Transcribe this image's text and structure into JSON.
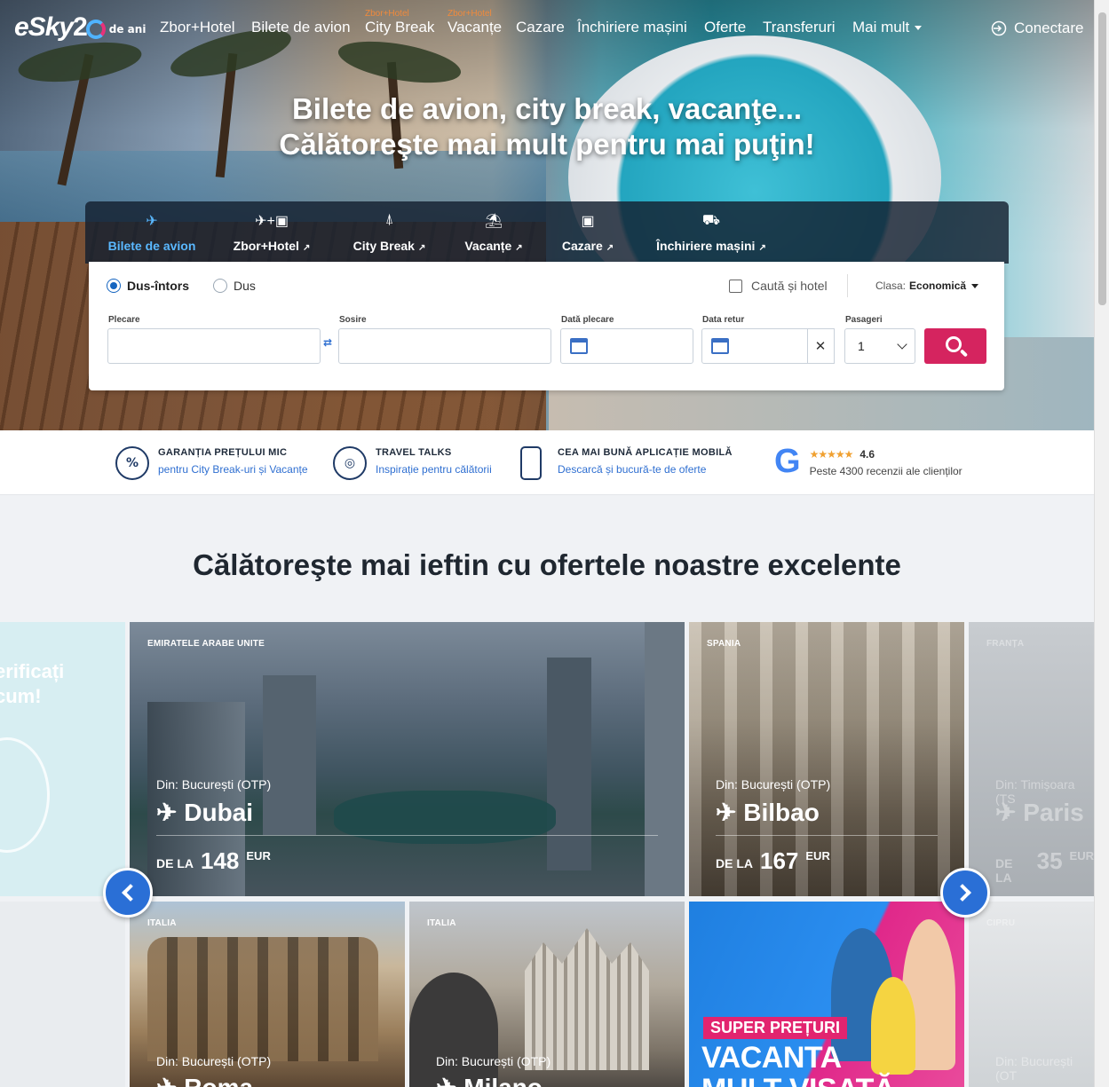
{
  "brand": {
    "logo_text": "eSky",
    "logo_number": "2",
    "logo_suffix": "de ani"
  },
  "nav": {
    "items": [
      {
        "label": "Zbor+Hotel",
        "sup": ""
      },
      {
        "label": "Bilete de avion",
        "sup": ""
      },
      {
        "label": "City Break",
        "sup": "Zbor+Hotel"
      },
      {
        "label": "Vacanțe",
        "sup": "Zbor+Hotel"
      },
      {
        "label": "Cazare",
        "sup": ""
      },
      {
        "label": "Închiriere mașini",
        "sup": ""
      },
      {
        "label": "Oferte",
        "sup": ""
      },
      {
        "label": "Transferuri",
        "sup": ""
      },
      {
        "label": "Mai mult",
        "sup": ""
      }
    ],
    "login_label": "Conectare"
  },
  "hero": {
    "title_line1": "Bilete de avion, city break, vacanţe...",
    "title_line2": "Călătoreşte mai mult pentru mai puţin!"
  },
  "search": {
    "tabs": [
      {
        "label": "Bilete de avion",
        "icon": "plane-icon",
        "active": true
      },
      {
        "label": "Zbor+Hotel",
        "icon": "plane-hotel-icon",
        "active": false
      },
      {
        "label": "City Break",
        "icon": "eiffel-tower-icon",
        "active": false
      },
      {
        "label": "Vacanțe",
        "icon": "beach-umbrella-icon",
        "active": false
      },
      {
        "label": "Cazare",
        "icon": "hotel-icon",
        "active": false
      },
      {
        "label": "Închiriere mașini",
        "icon": "car-icon",
        "active": false
      }
    ],
    "trip_types": [
      "Dus-întors",
      "Dus"
    ],
    "selected_trip": "Dus-întors",
    "hotel_checkbox_label": "Caută și hotel",
    "class_label": "Clasa:",
    "class_value": "Economică",
    "fields": {
      "departure_label": "Plecare",
      "departure_value": "",
      "arrival_label": "Sosire",
      "arrival_value": "",
      "date_out_label": "Dată plecare",
      "date_out_value": "",
      "date_return_label": "Data retur",
      "date_return_value": "",
      "passengers_label": "Pasageri",
      "passengers_value": "1"
    }
  },
  "benefits": [
    {
      "title": "GARANȚIA PREȚULUI MIC",
      "subtitle": "pentru City Break-uri și Vacanțe",
      "icon": "percent-badge-icon"
    },
    {
      "title": "TRAVEL TALKS",
      "subtitle": "Inspirație pentru călătorii",
      "icon": "globe-icon"
    },
    {
      "title": "CEA MAI BUNĂ APLICAȚIE MOBILĂ",
      "subtitle": "Descarcă și bucură-te de oferte",
      "icon": "smartphone-icon"
    }
  ],
  "rating": {
    "stars": "★★★★★",
    "value": "4.6",
    "text": "Peste 4300 recenzii ale clienților",
    "icon": "google-g-icon"
  },
  "offers_title": "Călătoreşte mai ieftin cu ofertele noastre excelente",
  "promo_left_text_1": "erificați",
  "promo_left_text_2": "cum!",
  "offers": [
    {
      "country": "EMIRATELE ARABE UNITE",
      "from": "Din: București (OTP)",
      "city": "Dubai",
      "price_prefix": "DE LA",
      "price": "148",
      "currency": "EUR"
    },
    {
      "country": "SPANIA",
      "from": "Din: București (OTP)",
      "city": "Bilbao",
      "price_prefix": "DE LA",
      "price": "167",
      "currency": "EUR"
    },
    {
      "country": "FRANȚA",
      "from": "Din: Timișoara (TS",
      "city": "Paris",
      "price_prefix": "DE LA",
      "price": "35",
      "currency": "EUR"
    },
    {
      "country": "ITALIA",
      "from": "Din: București (OTP)",
      "city": "Roma",
      "price_prefix": "",
      "price": "",
      "currency": ""
    },
    {
      "country": "ITALIA",
      "from": "Din: București (OTP)",
      "city": "Milano",
      "price_prefix": "",
      "price": "",
      "currency": ""
    },
    {
      "country": "CIPRU",
      "from": "Din: București (OT",
      "city": "",
      "price_prefix": "",
      "price": "",
      "currency": ""
    }
  ],
  "promo_ad": {
    "tag": "SUPER PREȚURI",
    "line1": "VACANTA",
    "line2": "MULT VISATĂ"
  }
}
